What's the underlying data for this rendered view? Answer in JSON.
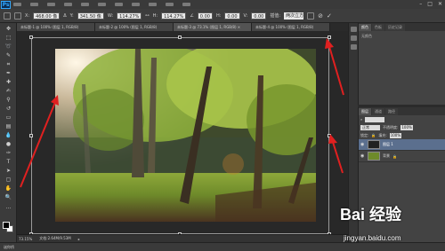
{
  "app": {
    "logo": "Ps"
  },
  "menubar": {
    "controls": [
      "–",
      "□",
      "✕"
    ]
  },
  "options": {
    "x_label": "X:",
    "x_value": "468.00 像",
    "y_label": "Y:",
    "y_value": "341.50 像",
    "w_label": "W:",
    "w_value": "114.27%",
    "h_label": "H:",
    "h_value": "114.27%",
    "angle_value": "0.00",
    "h_skew_label": "H:",
    "h_skew_value": "0.00",
    "v_skew_label": "V:",
    "v_skew_value": "0.00",
    "interp_label": "插值:",
    "interp_value": "两次立方"
  },
  "tabs": [
    {
      "label": "未标题-1 @ 100% (图层 1, RGB/8)"
    },
    {
      "label": "未标题-2 @ 100% (图层 1, RGB/8)"
    },
    {
      "label": "未标题-3 @ 73.1% (图层 1, RGB/8) ×"
    },
    {
      "label": "未标题-4 @ 100% (图层 1, RGB/8)"
    }
  ],
  "status": {
    "zoom": "73.15%",
    "doc_size": "文档:2.64M/9.53M"
  },
  "bottombar": {
    "label": "迷你桥"
  },
  "panels": {
    "top_tabs": [
      "颜色",
      "色板",
      "历史记录"
    ],
    "top_body": "无颜色",
    "layers_tabs": [
      "图层",
      "通道",
      "路径"
    ],
    "blend_mode": "正常",
    "opacity_label": "不透明度:",
    "opacity_value": "100%",
    "lock_label": "锁定:",
    "fill_label": "填充:",
    "fill_value": "100%",
    "layers": [
      {
        "name": "图层 1",
        "selected": true
      },
      {
        "name": "背景",
        "selected": false
      }
    ]
  },
  "watermark": {
    "logo": "Bai 经验",
    "url": "jingyan.baidu.com"
  },
  "colors": {
    "accent": "#31a8ff",
    "arrow": "#e02020",
    "selection": "#5b6f8e"
  }
}
